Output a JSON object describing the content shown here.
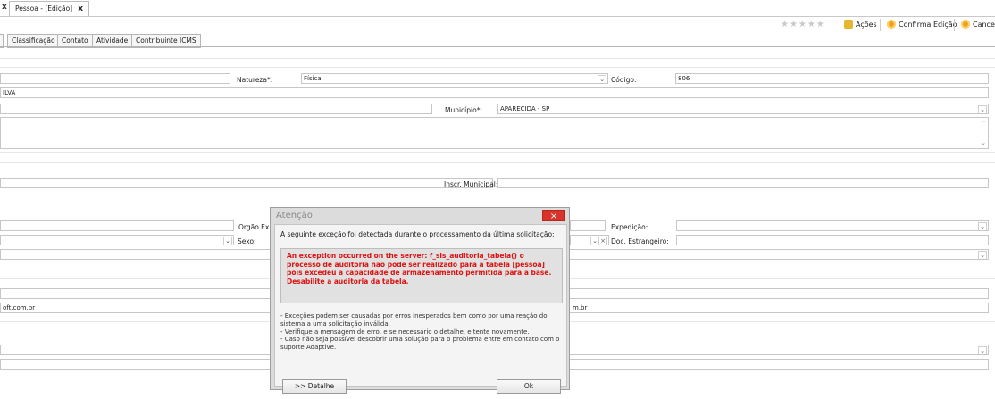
{
  "tabs": {
    "prev_close": "x",
    "current": "Pessoa - [Edição]",
    "current_close": "x"
  },
  "toolbar": {
    "rating_stars": "★★★★★",
    "actions": "Ações",
    "confirm": "Confirma Edição",
    "cancel": "Cancel"
  },
  "form_tabs": [
    "Classificação",
    "Contato",
    "Atividade",
    "Contribuinte ICMS"
  ],
  "form": {
    "natureza_label": "Natureza*:",
    "natureza_value": "Física",
    "codigo_label": "Código:",
    "codigo_value": "806",
    "name_value": "ILVA",
    "municipio_label": "Município*:",
    "municipio_value": "APARECIDA - SP",
    "inscr_municipal_label": "Inscr. Municipal:",
    "orgao_exp_label": "Orgão Expe",
    "expedicao_label": "Expedição:",
    "sexo_label": "Sexo:",
    "doc_estrangeiro_label": "Doc. Estrangeiro:",
    "email1_value": "oft.com.br",
    "email2_value": "m.br"
  },
  "dialog": {
    "title": "Atenção",
    "close": "×",
    "intro": "A seguinte exceção foi detectada durante o processamento da última solicitação:",
    "error": "An exception occurred on the server: f_sis_auditoria_tabela() o processo de auditoria não pode ser realizado para a tabela [pessoa] pois excedeu a capacidade de armazenamento permitida para a base. Desabilite a auditoria da tabela.",
    "note1": "- Exceções podem ser causadas por erros inesperados bem como por uma reação do sistema a uma solicitação inválida.",
    "note2": "- Verifique a mensagem de erro, e se necessário o detalhe, e tente novamente.",
    "note3": "- Caso não seja possível descobrir uma solução para o problema entre em contato com o suporte Adaptive.",
    "detail_button": ">> Detalhe",
    "ok_button": "Ok"
  }
}
